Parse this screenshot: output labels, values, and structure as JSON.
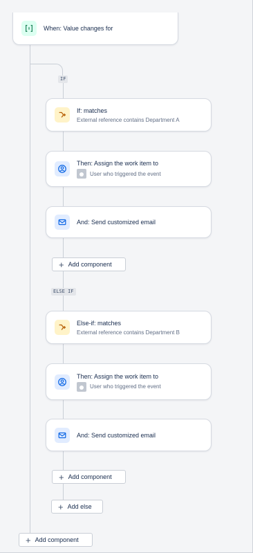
{
  "trigger": {
    "icon": "code-brackets-icon",
    "title": "When: Value changes for"
  },
  "if_branch": {
    "tag": "IF",
    "condition": {
      "icon": "branch-icon",
      "title": "If: matches",
      "subtitle": "External reference contains Department A"
    },
    "assign": {
      "icon": "user-circle-icon",
      "title": "Then: Assign the work item to",
      "subtitle": "User who triggered the event"
    },
    "email": {
      "icon": "mail-icon",
      "title": "And: Send customized email"
    },
    "add_component_label": "Add component"
  },
  "elseif_branch": {
    "tag": "ELSE IF",
    "condition": {
      "icon": "branch-icon",
      "title": "Else-if: matches",
      "subtitle": "External reference contains Department B"
    },
    "assign": {
      "icon": "user-circle-icon",
      "title": "Then: Assign the work item to",
      "subtitle": "User who triggered the event"
    },
    "email": {
      "icon": "mail-icon",
      "title": "And: Send customized email"
    },
    "add_component_label": "Add component"
  },
  "add_else_label": "Add else",
  "root_add_component_label": "Add component",
  "colors": {
    "background": "#f4f5f7",
    "card_border": "#d6dae1",
    "connector": "#c9ced6",
    "green_icon_bg": "#dcfff1",
    "yellow_icon_bg": "#fff3c8",
    "blue_icon_bg": "#e1ecff"
  }
}
